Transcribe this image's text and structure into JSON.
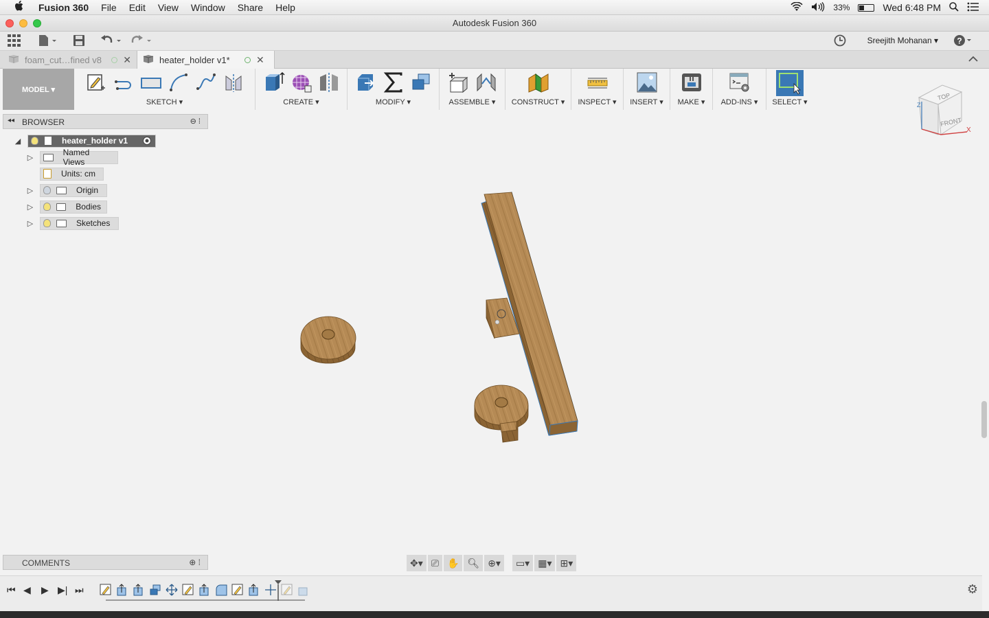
{
  "menubar": {
    "apple_icon": "apple-logo-icon",
    "app_name": "Fusion 360",
    "menus": [
      "File",
      "Edit",
      "View",
      "Window",
      "Share",
      "Help"
    ],
    "battery": "33%",
    "clock": "Wed 6:48 PM"
  },
  "window": {
    "title": "Autodesk Fusion 360"
  },
  "quick_access": {
    "user_name": "Sreejith Mohanan ▾"
  },
  "tabs": [
    {
      "label": "foam_cut…fined v8",
      "active": false
    },
    {
      "label": "heater_holder v1*",
      "active": true
    }
  ],
  "toolbar": {
    "mode": "MODEL ▾",
    "groups": {
      "sketch": "SKETCH ▾",
      "create": "CREATE ▾",
      "modify": "MODIFY ▾",
      "assemble": "ASSEMBLE ▾",
      "construct": "CONSTRUCT ▾",
      "inspect": "INSPECT ▾",
      "insert": "INSERT ▾",
      "make": "MAKE ▾",
      "addins": "ADD-INS ▾",
      "select": "SELECT ▾"
    }
  },
  "browser": {
    "title": "BROWSER",
    "root": "heater_holder v1",
    "items": [
      {
        "label": "Named Views"
      },
      {
        "label": "Units: cm"
      },
      {
        "label": "Origin"
      },
      {
        "label": "Bodies"
      },
      {
        "label": "Sketches"
      }
    ]
  },
  "viewcube": {
    "top": "TOP",
    "front": "FRONT",
    "x_axis": "X",
    "z_axis": "Z"
  },
  "comments": {
    "title": "COMMENTS"
  },
  "colors": {
    "wood_light": "#b58a55",
    "wood_dark": "#8b6434",
    "select_blue": "#3a78b5"
  }
}
